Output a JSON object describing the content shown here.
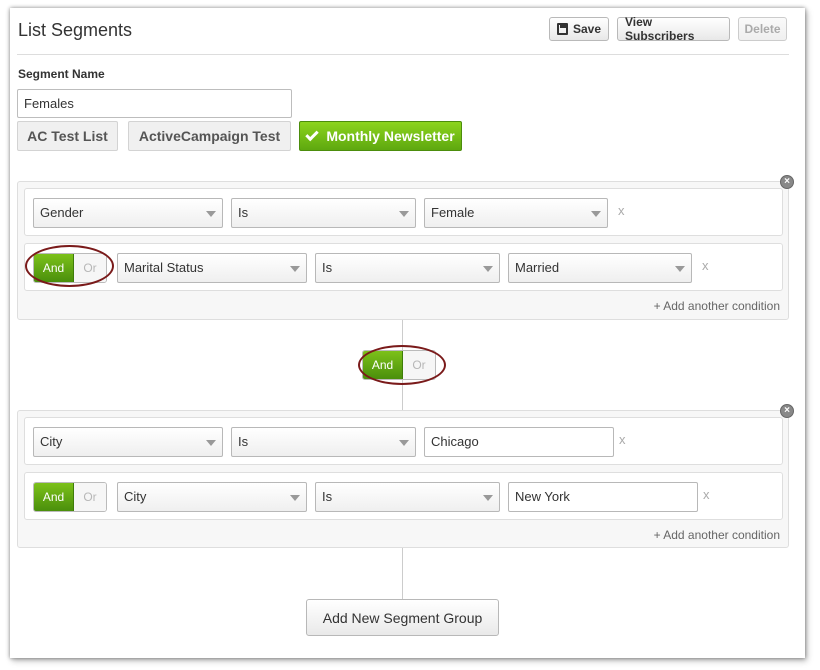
{
  "header": {
    "title": "List Segments",
    "save_label": "Save",
    "view_subscribers_label": "View Subscribers",
    "delete_label": "Delete"
  },
  "segment": {
    "name_label": "Segment Name",
    "name_value": "Females",
    "lists": [
      {
        "label": "AC Test List",
        "selected": false
      },
      {
        "label": "ActiveCampaign Test",
        "selected": false
      },
      {
        "label": "Monthly Newsletter",
        "selected": true
      }
    ]
  },
  "groups": [
    {
      "conditions": [
        {
          "field": "Gender",
          "operator": "Is",
          "value": "Female",
          "value_type": "select"
        },
        {
          "connector": {
            "on": "And",
            "off": "Or"
          },
          "field": "Marital Status",
          "operator": "Is",
          "value": "Married",
          "value_type": "select"
        }
      ],
      "add_condition_label": "+ Add another condition"
    },
    {
      "conditions": [
        {
          "field": "City",
          "operator": "Is",
          "value": "Chicago",
          "value_type": "text"
        },
        {
          "connector": {
            "on": "And",
            "off": "Or"
          },
          "field": "City",
          "operator": "Is",
          "value": "New York",
          "value_type": "text"
        }
      ],
      "add_condition_label": "+ Add another condition"
    }
  ],
  "group_connector": {
    "on": "And",
    "off": "Or"
  },
  "remove_glyph": "x",
  "close_glyph": "×",
  "add_group_label": "Add New Segment Group",
  "colors": {
    "accent_green": "#5ea80f",
    "annotation_oval": "#7a1a1a"
  }
}
